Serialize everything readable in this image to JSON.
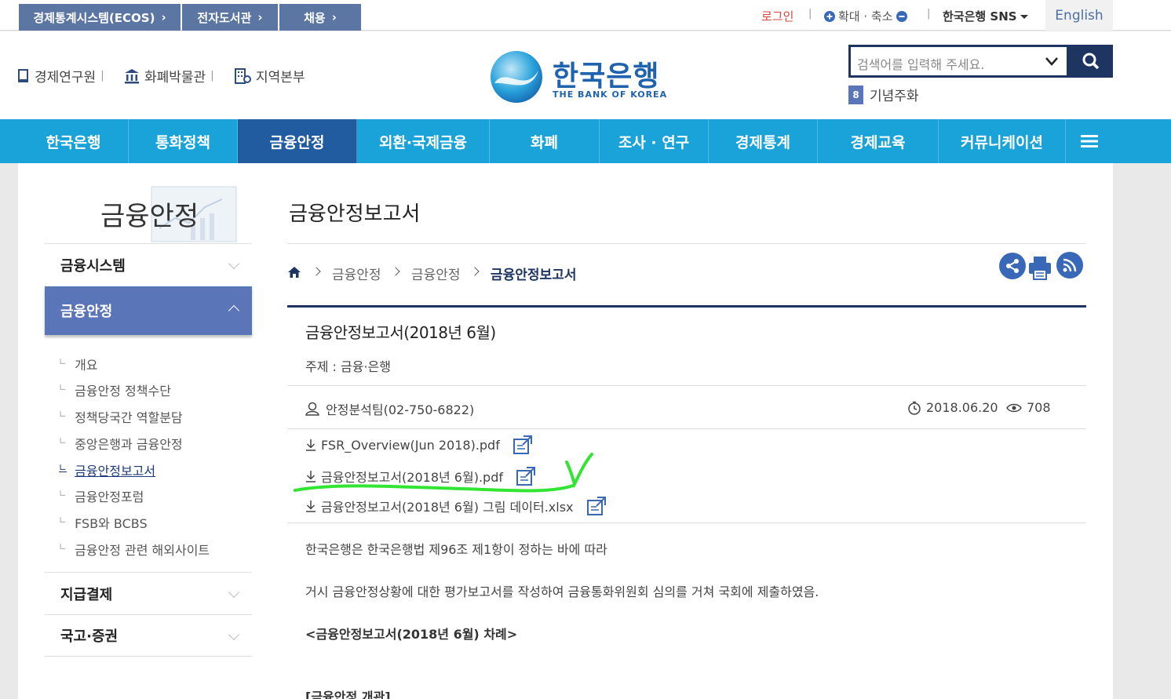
{
  "util": {
    "tabs": [
      "경제통계시스템(ECOS)",
      "전자도서관",
      "채용"
    ],
    "login": "로그인",
    "zoom": "확대 · 축소",
    "sns": "한국은행 SNS",
    "english": "English"
  },
  "header": {
    "links": [
      "경제연구원",
      "화폐박물관",
      "지역본부"
    ],
    "logo_kr": "한국은행",
    "logo_en": "THE BANK OF KOREA",
    "search_placeholder": "검색어를 입력해 주세요.",
    "coin_badge": "8",
    "coin_label": "기념주화"
  },
  "gnb": [
    "한국은행",
    "통화정책",
    "금융안정",
    "외환·국제금융",
    "화폐",
    "조사 · 연구",
    "경제통계",
    "경제교육",
    "커뮤니케이션"
  ],
  "lnb": {
    "title": "금융안정",
    "menu_top": "금융시스템",
    "menu_active": "금융안정",
    "subs": [
      "개요",
      "금융안정 정책수단",
      "정책당국간 역할분담",
      "중앙은행과 금융안정",
      "금융안정보고서",
      "금융안정포럼",
      "FSB와 BCBS",
      "금융안정 관련 해외사이트"
    ],
    "menu_bottom": [
      "지급결제",
      "국고·증권"
    ]
  },
  "main": {
    "page_title": "금융안정보고서",
    "breadcrumb": [
      "금융안정",
      "금융안정",
      "금융안정보고서"
    ],
    "article_title": "금융안정보고서(2018년 6월)",
    "subject": "주제 : 금융·은행",
    "author": "안정분석팀(02-750-6822)",
    "date": "2018.06.20",
    "views": "708",
    "files": [
      "FSR_Overview(Jun 2018).pdf",
      "금융안정보고서(2018년 6월).pdf",
      "금융안정보고서(2018년 6월) 그림 데이터.xlsx"
    ],
    "body1": "한국은행은 한국은행법 제96조 제1항이 정하는 바에 따라",
    "body2": "거시 금융안정상황에 대한 평가보고서를 작성하여 금융통화위원회 심의를 거쳐 국회에 제출하였음.",
    "toc": "<금융안정보고서(2018년 6월) 차례>",
    "section": "[금융안정 개관]"
  },
  "colors": {
    "gnb": "#1aa3d9",
    "gnb_active": "#215ba0",
    "lnb_active": "#5b76b8",
    "annotation": "#33e533"
  }
}
